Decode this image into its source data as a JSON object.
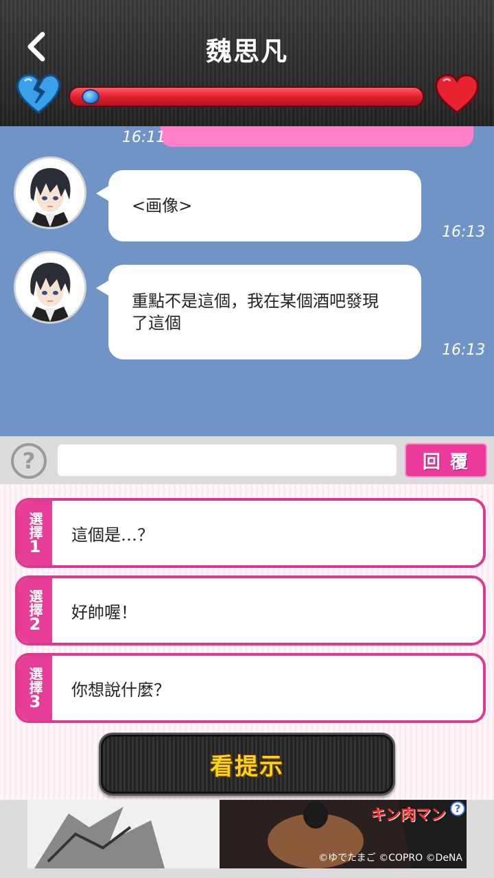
{
  "header": {
    "title": "魏思凡",
    "back_icon": "chevron-left-icon",
    "left_heart_icon": "broken-heart-icon",
    "right_heart_icon": "heart-icon",
    "affection_level": 0.03,
    "colors": {
      "broken_heart": "#3aa0e8",
      "heart": "#e0202e",
      "bar": "#e0202e"
    }
  },
  "chat": {
    "background": "#7094c6",
    "sent_timestamp": "16:11",
    "messages": [
      {
        "sender": "魏思凡",
        "text": "<画像>",
        "time": "16:13"
      },
      {
        "sender": "魏思凡",
        "text": "重點不是這個，我在某個酒吧發現了這個",
        "time": "16:13"
      }
    ]
  },
  "reply": {
    "help_label": "?",
    "input_value": "",
    "button_label": "回覆"
  },
  "choices": [
    {
      "tag": "選擇",
      "num": "1",
      "text": "這個是…？"
    },
    {
      "tag": "選擇",
      "num": "2",
      "text": "好帥喔！"
    },
    {
      "tag": "選擇",
      "num": "3",
      "text": "你想說什麼？"
    }
  ],
  "hint": {
    "label": "看提示"
  },
  "ad": {
    "logo": "キン肉マン",
    "credit": "©ゆでたまご ©COPRO ©DeNA",
    "help_label": "?"
  }
}
